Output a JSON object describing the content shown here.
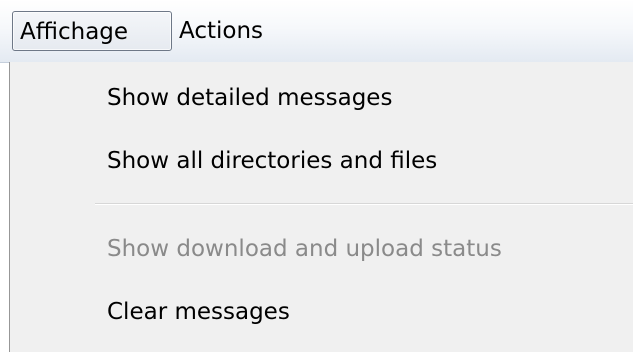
{
  "menubar": {
    "items": [
      {
        "label": "Affichage",
        "state": "open"
      },
      {
        "label": "Actions",
        "state": "normal"
      }
    ]
  },
  "dropdown": {
    "items": [
      {
        "label": "Show detailed messages",
        "enabled": true
      },
      {
        "label": "Show all directories and files",
        "enabled": true
      },
      {
        "label": "Show download and upload status",
        "enabled": false
      },
      {
        "label": "Clear messages",
        "enabled": true
      }
    ]
  },
  "colors": {
    "menu_background": "#f0f0f0",
    "disabled_text": "#8a8a8a",
    "text": "#000000"
  }
}
